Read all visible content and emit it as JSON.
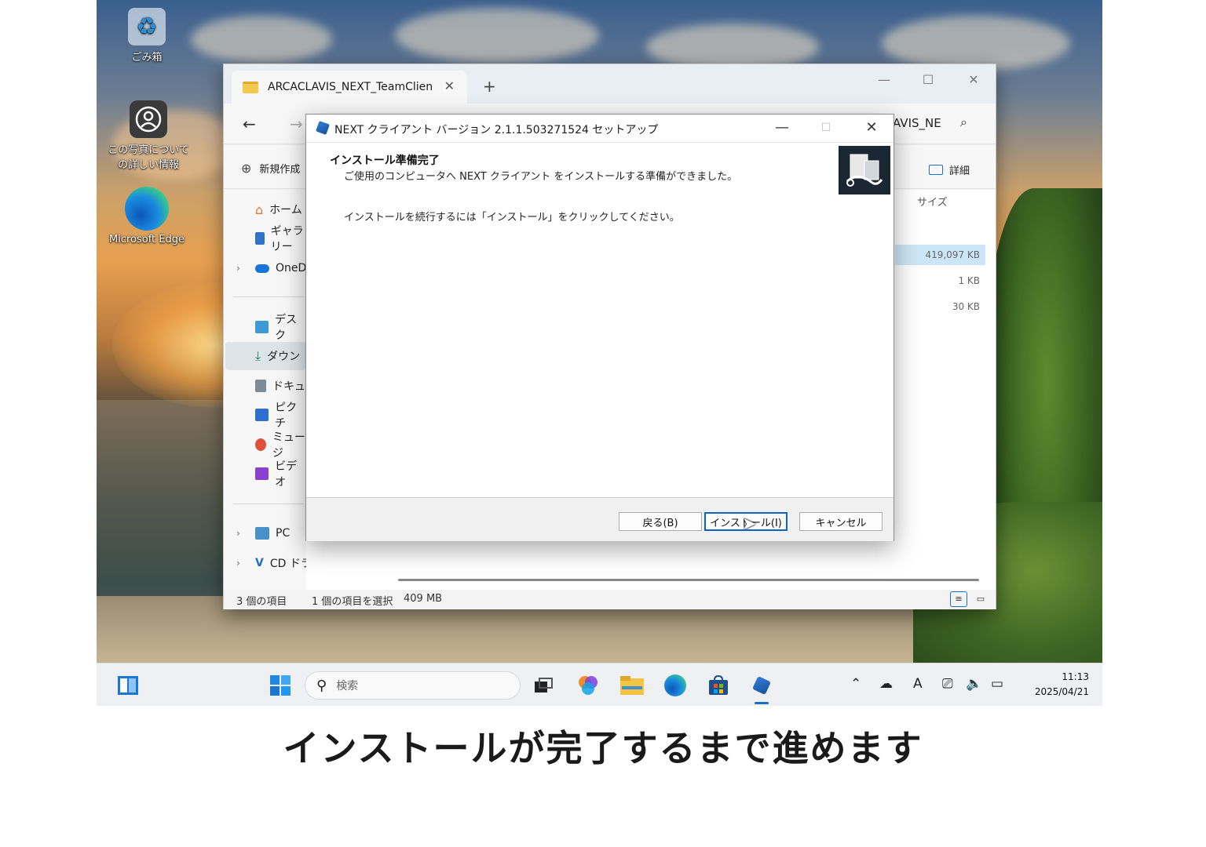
{
  "desktop": {
    "icons": [
      {
        "label": "ごみ箱",
        "icon": "recycle-bin-icon"
      },
      {
        "label": "この写真についての詳しい情報",
        "icon": "spotlight-info-icon"
      },
      {
        "label": "Microsoft Edge",
        "icon": "edge-icon"
      }
    ]
  },
  "explorer": {
    "tab_title": "ARCACLAVIS_NEXT_TeamClien",
    "address_tail": "AVIS_NE",
    "new_label": "新規作成",
    "detail_label": "詳細",
    "column_size": "サイズ",
    "sizes": [
      "419,097 KB",
      "1 KB",
      "30 KB"
    ],
    "sidebar": {
      "home": "ホーム",
      "gallery": "ギャラリー",
      "onedrive": "OneD",
      "desktop": "デスク",
      "downloads": "ダウン",
      "documents": "ドキュ",
      "pictures": "ピクチ",
      "music": "ミュージ",
      "videos": "ビデオ",
      "pc": "PC",
      "cd_drive": "CD ドライブ (D:) V"
    },
    "status": {
      "items": "3 個の項目",
      "selected": "1 個の項目を選択",
      "size": "409 MB"
    }
  },
  "setup": {
    "title": "NEXT クライアント バージョン 2.1.1.503271524 セットアップ",
    "heading": "インストール準備完了",
    "subheading": "ご使用のコンピュータへ NEXT クライアント をインストールする準備ができました。",
    "body": "インストールを続行するには「インストール」をクリックしてください。",
    "buttons": {
      "back": "戻る(B)",
      "install": "インストール(I)",
      "cancel": "キャンセル"
    }
  },
  "taskbar": {
    "search_placeholder": "検索",
    "time": "11:13",
    "date": "2025/04/21"
  },
  "caption": "インストールが完了するまで進めます",
  "colors": {
    "accent": "#0a64c8",
    "selection": "#cde6f7"
  }
}
